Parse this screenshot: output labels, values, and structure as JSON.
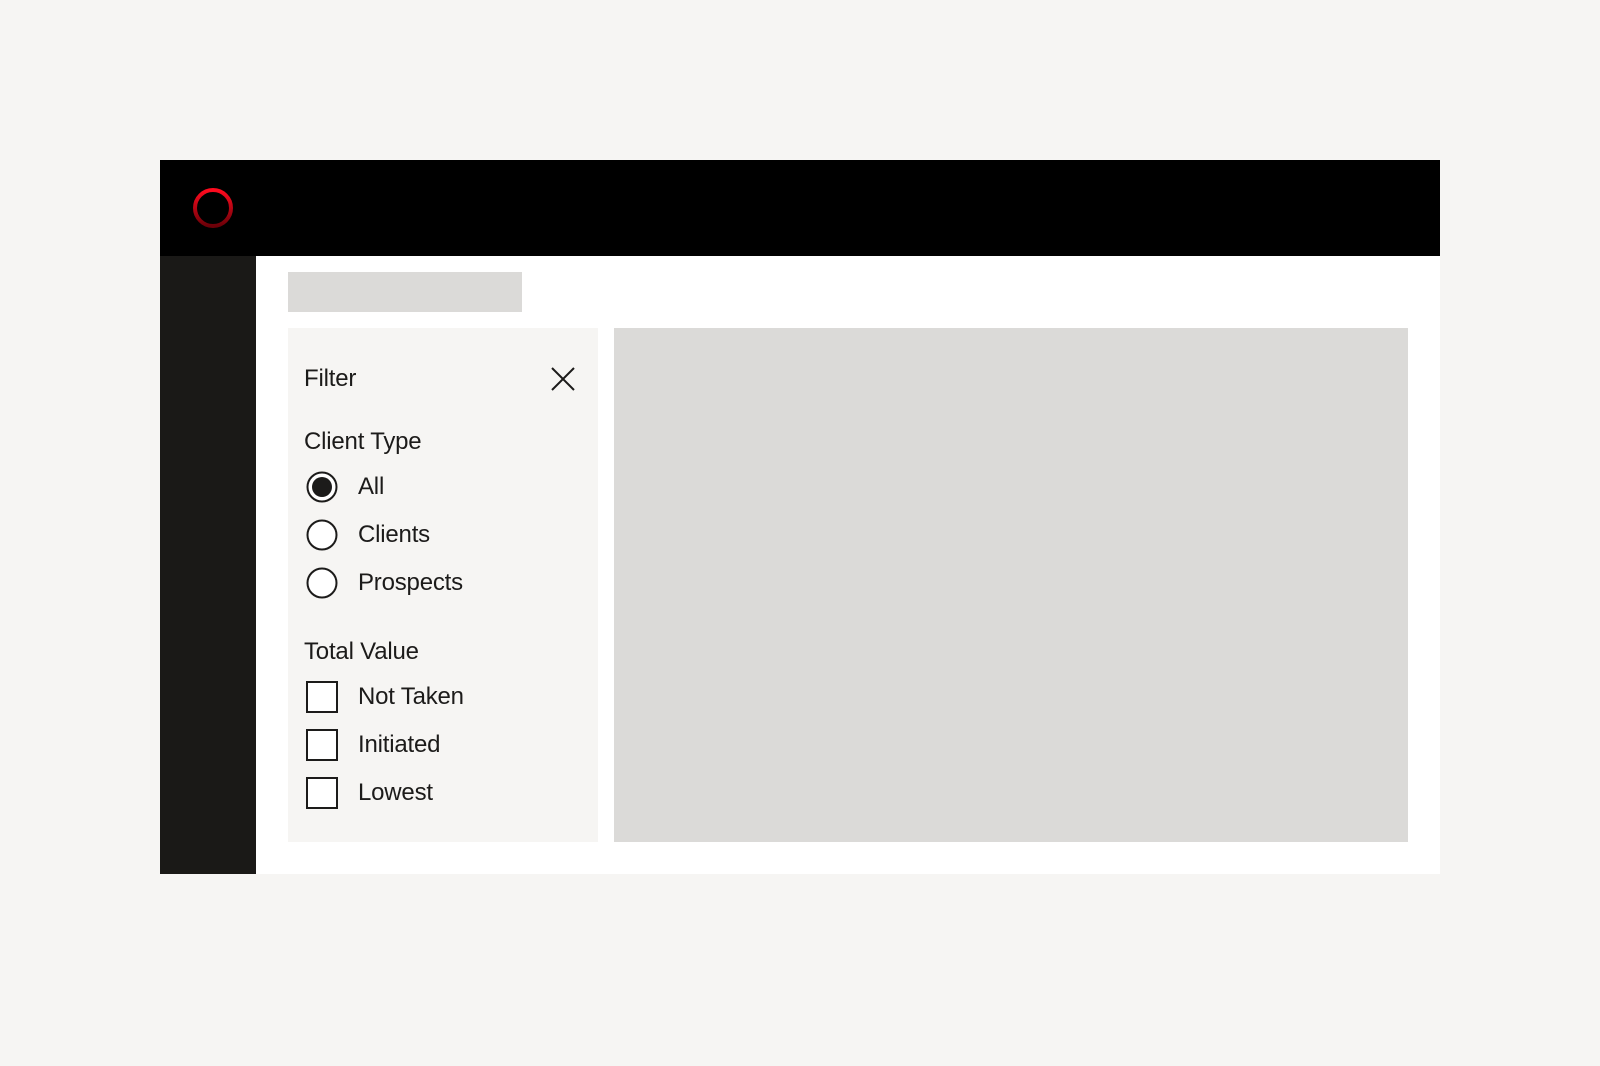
{
  "colors": {
    "page_background": "#f6f5f3",
    "topbar": "#000000",
    "sidebar": "#1a1917",
    "panel_background": "#f6f5f3",
    "placeholder": "#dbdad8",
    "logo_ring": "#e30613",
    "text": "#1c1b1a"
  },
  "header": {
    "logo_icon": "ring-logo-icon"
  },
  "filter": {
    "title": "Filter",
    "close_icon": "close-icon",
    "client_type": {
      "label": "Client Type",
      "selected": "All",
      "options": [
        {
          "label": "All",
          "checked": true
        },
        {
          "label": "Clients",
          "checked": false
        },
        {
          "label": "Prospects",
          "checked": false
        }
      ]
    },
    "total_value": {
      "label": "Total Value",
      "options": [
        {
          "label": "Not Taken",
          "checked": false
        },
        {
          "label": "Initiated",
          "checked": false
        },
        {
          "label": "Lowest",
          "checked": false
        }
      ]
    }
  }
}
